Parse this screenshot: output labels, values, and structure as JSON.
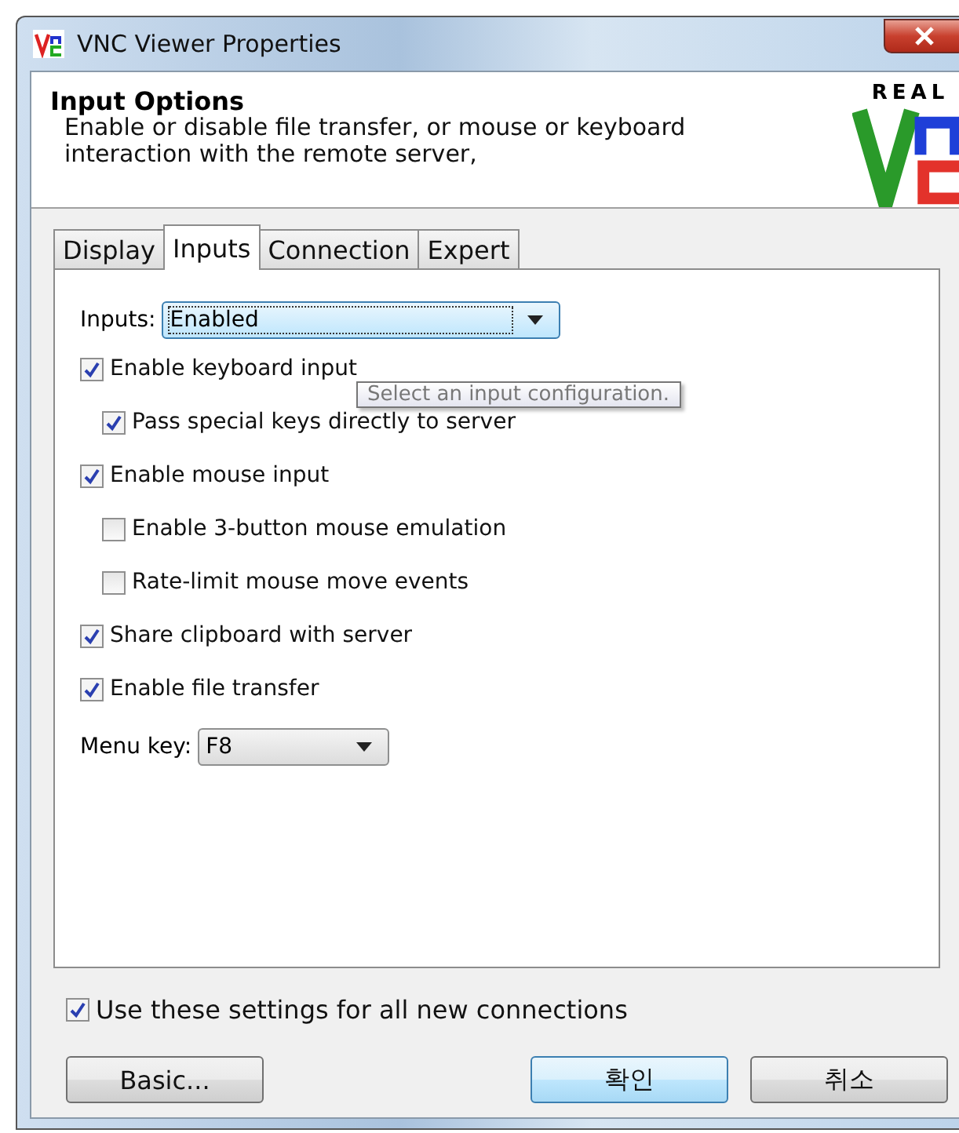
{
  "window": {
    "title": "VNC Viewer Properties"
  },
  "header": {
    "title": "Input Options",
    "description": "Enable or disable file transfer, or mouse or keyboard interaction with the remote server,"
  },
  "logo": {
    "top": "REAL"
  },
  "tabs": [
    {
      "label": "Display",
      "selected": false
    },
    {
      "label": "Inputs",
      "selected": true
    },
    {
      "label": "Connection",
      "selected": false
    },
    {
      "label": "Expert",
      "selected": false
    }
  ],
  "inputs": {
    "label": "Inputs:",
    "value": "Enabled"
  },
  "tooltip": "Select an input configuration.",
  "options": [
    {
      "label": "Enable keyboard input",
      "checked": true,
      "indented": false
    },
    {
      "label": "Pass special keys directly to server",
      "checked": true,
      "indented": true
    },
    {
      "label": "Enable mouse input",
      "checked": true,
      "indented": false
    },
    {
      "label": "Enable 3-button mouse emulation",
      "checked": false,
      "indented": true
    },
    {
      "label": "Rate-limit mouse move events",
      "checked": false,
      "indented": true
    },
    {
      "label": "Share clipboard with server",
      "checked": true,
      "indented": false
    },
    {
      "label": "Enable file transfer",
      "checked": true,
      "indented": false
    }
  ],
  "menu_key": {
    "label": "Menu key:",
    "value": "F8"
  },
  "use_for_all": {
    "label": "Use these settings for all new connections",
    "checked": true
  },
  "buttons": [
    {
      "label": "Basic...",
      "default": false
    },
    {
      "label": "확인",
      "default": true
    },
    {
      "label": "취소",
      "default": false
    }
  ]
}
